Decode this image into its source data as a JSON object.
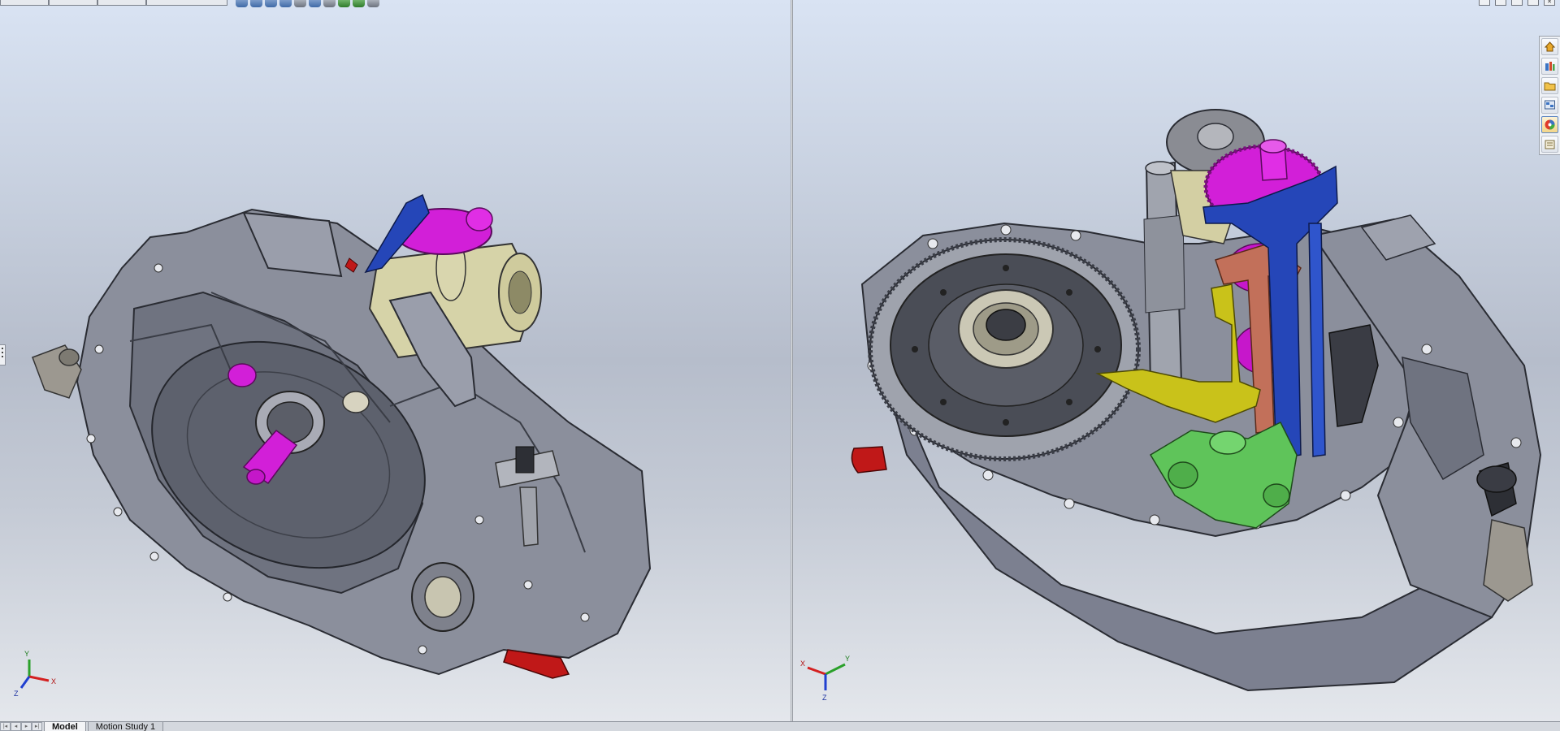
{
  "window": {
    "controls": [
      "minimize-icon",
      "restore-icon",
      "close-icon"
    ]
  },
  "hud": {
    "icons": [
      "zoom-to-fit-icon",
      "zoom-area-icon",
      "previous-view-icon",
      "section-view-icon",
      "view-orientation-icon",
      "display-style-icon",
      "hide-show-icon",
      "edit-appearance-icon",
      "apply-scene-icon",
      "view-settings-icon"
    ]
  },
  "task_pane": {
    "buttons": [
      "resources-icon",
      "design-library-icon",
      "file-explorer-icon",
      "view-palette-icon",
      "appearances-icon",
      "custom-properties-icon"
    ]
  },
  "viewports": {
    "left": {
      "triad": {
        "x": "X",
        "y": "Y",
        "z": "Z"
      }
    },
    "right": {
      "triad": {
        "x": "X",
        "y": "Y",
        "z": "Z"
      }
    }
  },
  "tabs": [
    {
      "label": "Model",
      "active": true
    },
    {
      "label": "Motion Study 1",
      "active": false
    }
  ],
  "colors": {
    "housing": "#8b8f9c",
    "gear_magenta": "#d21fd8",
    "fork_blue": "#2546b8",
    "fork_yellow": "#c9c21a",
    "fork_copper": "#c2705a",
    "mechanism_green": "#5fc45a",
    "starter_khaki": "#d6d3a8",
    "lever_red": "#c01818"
  }
}
